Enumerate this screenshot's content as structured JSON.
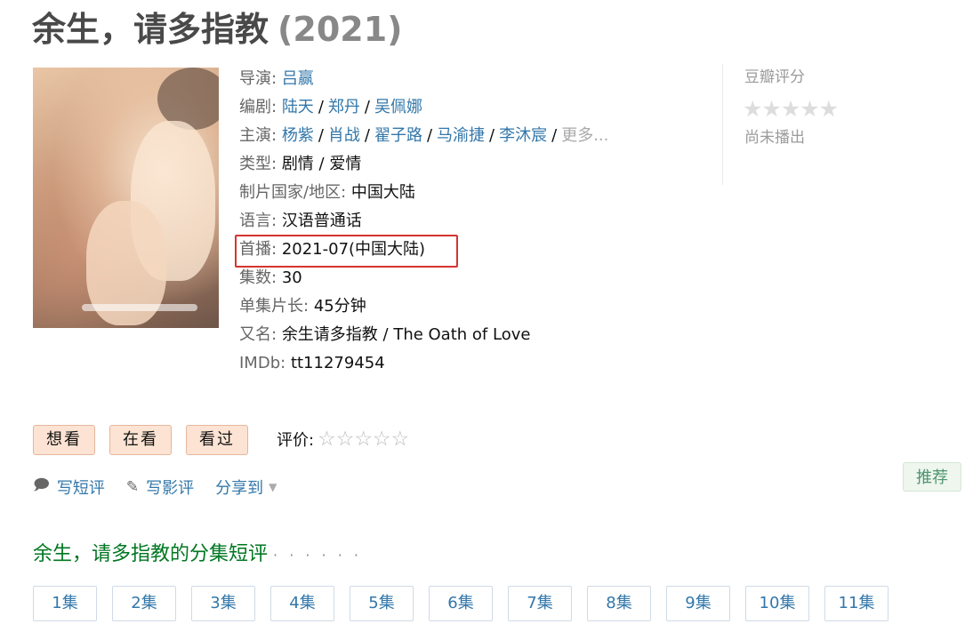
{
  "title": {
    "name": "余生，请多指教",
    "year": "(2021)"
  },
  "info": {
    "director": {
      "label": "导演:",
      "names": [
        "吕赢"
      ]
    },
    "writer": {
      "label": "编剧:",
      "names": [
        "陆天",
        "郑丹",
        "吴佩娜"
      ]
    },
    "cast": {
      "label": "主演:",
      "names": [
        "杨紫",
        "肖战",
        "翟子路",
        "马渝捷",
        "李沐宸"
      ],
      "more": "更多..."
    },
    "genre": {
      "label": "类型:",
      "value": "剧情 / 爱情"
    },
    "country": {
      "label": "制片国家/地区:",
      "value": "中国大陆"
    },
    "language": {
      "label": "语言:",
      "value": "汉语普通话"
    },
    "premiere": {
      "label": "首播:",
      "value": "2021-07(中国大陆)"
    },
    "episodes": {
      "label": "集数:",
      "value": "30"
    },
    "runtime": {
      "label": "单集片长:",
      "value": "45分钟"
    },
    "aka": {
      "label": "又名:",
      "value": "余生请多指教 / The Oath of Love"
    },
    "imdb": {
      "label": "IMDb:",
      "value": "tt11279454"
    }
  },
  "rating": {
    "label": "豆瓣评分",
    "stars": "★★★★★",
    "status": "尚未播出"
  },
  "actions": {
    "want": "想看",
    "watching": "在看",
    "watched": "看过",
    "rate_label": "评价:",
    "rate_stars": "☆☆☆☆☆"
  },
  "links": {
    "short_review": "写短评",
    "review": "写影评",
    "share": "分享到"
  },
  "recommend": "推荐",
  "section": {
    "title": "余生，请多指教的分集短评",
    "dots": "· · · · · ·"
  },
  "episodes_list": [
    "1集",
    "2集",
    "3集",
    "4集",
    "5集",
    "6集",
    "7集",
    "8集",
    "9集",
    "10集",
    "11集"
  ],
  "colors": {
    "link": "#3377aa",
    "highlight": "#d63333",
    "section": "#007722",
    "button_bg": "#fde3d3"
  }
}
